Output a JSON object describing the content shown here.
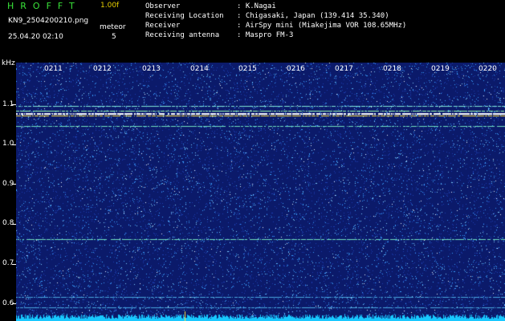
{
  "header": {
    "app_title": "HROFFT",
    "version": "1.00f",
    "file_name": "KN9_2504200210.png",
    "mode": "meteor",
    "timestamp": "25.04.20 02:10",
    "count": "5"
  },
  "station_info": [
    {
      "label": "Observer",
      "value": ": K.Nagai"
    },
    {
      "label": "Receiving Location",
      "value": ": Chigasaki, Japan (139.414 35.340)"
    },
    {
      "label": "Receiver",
      "value": ": AirSpy mini (Miakejima VOR 108.65MHz)"
    },
    {
      "label": "Receiving antenna",
      "value": ": Maspro FM-3"
    }
  ],
  "spectrogram": {
    "y_unit": "kHz",
    "y_ticks": [
      "1.1",
      "1.0",
      "0.9",
      "0.8",
      "0.7",
      "0.6"
    ],
    "x_ticks": [
      "0211",
      "0212",
      "0213",
      "0214",
      "0215",
      "0216",
      "0217",
      "0218",
      "0219",
      "0220"
    ],
    "colors": {
      "background": "#0b1a6a",
      "noise": "#3aa0ff",
      "signal": "#9cffb0",
      "carrier": "#ffffff",
      "baseline": "#18c8ff"
    }
  }
}
